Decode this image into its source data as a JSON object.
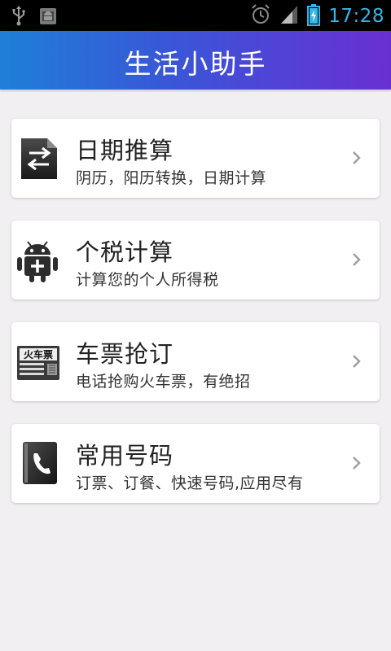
{
  "status_bar": {
    "time": "17:28",
    "icons": [
      "usb-icon",
      "android-debug-icon",
      "alarm-icon",
      "signal-icon",
      "battery-charging-icon"
    ]
  },
  "header": {
    "title": "生活小助手"
  },
  "cards": [
    {
      "title": "日期推算",
      "subtitle": "阴历，阳历转换，日期计算",
      "icon": "date-swap-icon"
    },
    {
      "title": "个税计算",
      "subtitle": "计算您的个人所得税",
      "icon": "android-tax-icon"
    },
    {
      "title": "车票抢订",
      "subtitle": "电话抢购火车票，有绝招",
      "icon": "train-ticket-icon",
      "icon_text": "火车票"
    },
    {
      "title": "常用号码",
      "subtitle": "订票、订餐、快速号码,应用尽有",
      "icon": "phone-book-icon"
    }
  ],
  "colors": {
    "status_text": "#33b5e5",
    "header_gradient_start": "#1f7fd8",
    "header_gradient_end": "#6a2fd2",
    "background": "#f2eff2",
    "card": "#ffffff"
  }
}
